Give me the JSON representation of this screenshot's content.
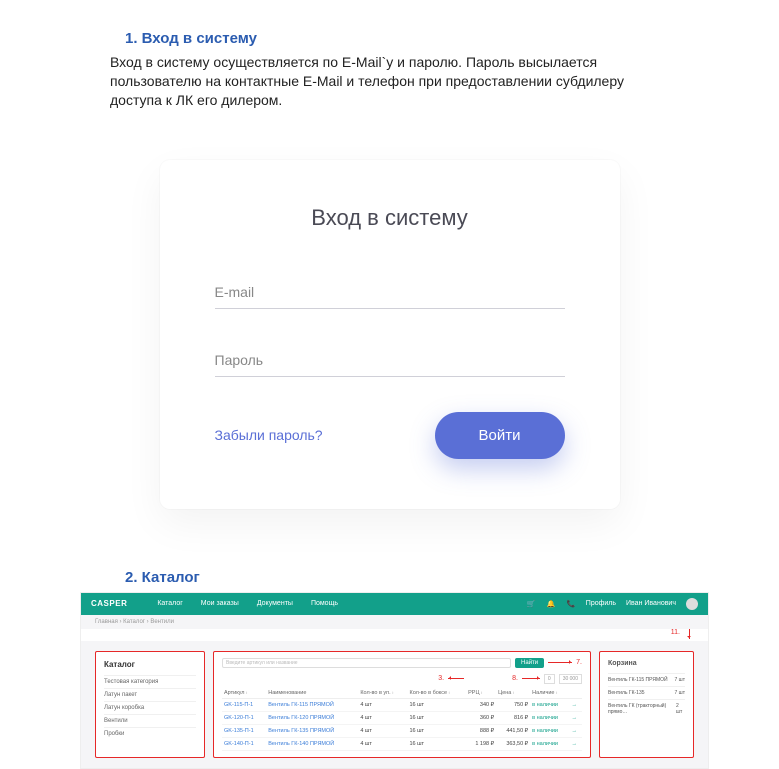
{
  "section1": {
    "heading": "1.   Вход в систему",
    "body": "Вход в систему осуществляется по E-Mail`у и паролю. Пароль высылается пользователю на контактные E-Mail и телефон при предоставлении субдилеру доступа к ЛК его дилером."
  },
  "login": {
    "title": "Вход в систему",
    "email_placeholder": "E-mail",
    "password_placeholder": "Пароль",
    "forgot": "Забыли пароль?",
    "button": "Войти"
  },
  "section2": {
    "heading": "2.   Каталог"
  },
  "catalog": {
    "logo": "CASPER",
    "nav": [
      "Каталог",
      "Мои заказы",
      "Документы",
      "Помощь"
    ],
    "user_role": "Профиль",
    "user_name": "Иван Иванович",
    "crumbs": "Главная  ›  Каталог  ›  Вентили",
    "sidebar": {
      "title": "Каталог",
      "items": [
        "Тестовая категория",
        "Латун пакет",
        "Латун коробка",
        "Вентили",
        "Пробки"
      ]
    },
    "search_placeholder": "Введите артикул или название",
    "search_btn": "Найти",
    "pointers": {
      "p3": "3.",
      "p7": "7.",
      "p8": "8.",
      "p11": "11."
    },
    "range": {
      "from": "0",
      "to": "30 000"
    },
    "columns": [
      "Артикул",
      "Наименование",
      "Кол-во в уп.",
      "Кол-во в боксе",
      "РРЦ",
      "Цена",
      "Наличие"
    ],
    "rows": [
      {
        "art": "GK-115-П-1",
        "name": "Вентиль ГК-115 ПРЯМОЙ",
        "pack": "4 шт",
        "box": "16 шт",
        "rrc": "340 ₽",
        "price": "750 ₽",
        "stock": "в наличии"
      },
      {
        "art": "GK-120-П-1",
        "name": "Вентиль ГК-120 ПРЯМОЙ",
        "pack": "4 шт",
        "box": "16 шт",
        "rrc": "360 ₽",
        "price": "816 ₽",
        "stock": "в наличии"
      },
      {
        "art": "GK-135-П-1",
        "name": "Вентиль ГК-135 ПРЯМОЙ",
        "pack": "4 шт",
        "box": "16 шт",
        "rrc": "888 ₽",
        "price": "441,50 ₽",
        "stock": "в наличии"
      },
      {
        "art": "GK-140-П-1",
        "name": "Вентиль ГК-140 ПРЯМОЙ",
        "pack": "4 шт",
        "box": "16 шт",
        "rrc": "1 198 ₽",
        "price": "363,50 ₽",
        "stock": "в наличии"
      }
    ],
    "cart": {
      "title": "Корзина",
      "items": [
        {
          "name": "Вентиль ГК-115 ПРЯМОЙ",
          "qty": "7 шт"
        },
        {
          "name": "Вентиль ГК-135",
          "qty": "7 шт"
        },
        {
          "name": "Вентиль ГК (тракторный) прямо…",
          "qty": "2 шт"
        }
      ]
    }
  }
}
